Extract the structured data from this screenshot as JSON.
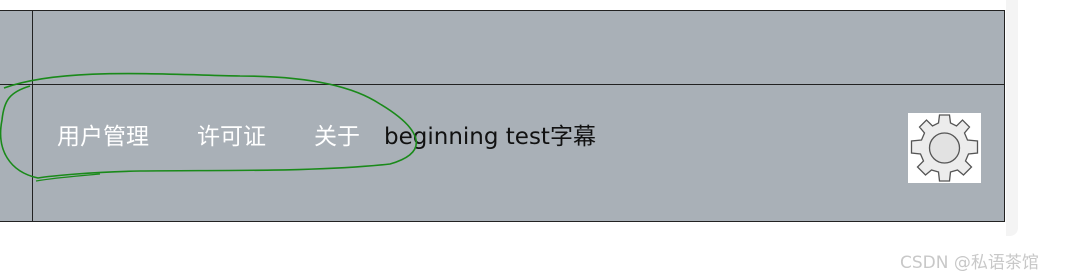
{
  "nav": {
    "items": [
      {
        "label": "用户管理"
      },
      {
        "label": "许可证"
      },
      {
        "label": "关于"
      }
    ],
    "marquee_text": "beginning test字幕"
  },
  "settings": {
    "icon": "gear-icon"
  },
  "annotation": {
    "color": "#1a8a1a"
  },
  "watermark": {
    "text": "CSDN @私语茶馆"
  },
  "colors": {
    "panel_bg": "#a9b0b7",
    "nav_text": "#ffffff",
    "marquee_text": "#111111"
  }
}
